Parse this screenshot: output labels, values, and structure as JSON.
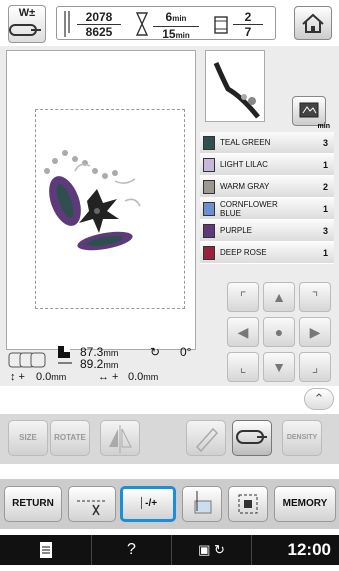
{
  "topbar": {
    "wt_label": "W±",
    "stitch_current": "2078",
    "stitch_total": "8625",
    "time_current": "6",
    "time_total": "15",
    "time_unit": "min",
    "color_current": "2",
    "color_total": "7"
  },
  "colors": {
    "min_label": "min",
    "items": [
      {
        "name": "TEAL GREEN",
        "count": "3",
        "color": "#2f4f4f"
      },
      {
        "name": "LIGHT LILAC",
        "count": "1",
        "color": "#c8b8d8"
      },
      {
        "name": "WARM GRAY",
        "count": "2",
        "color": "#9a9890"
      },
      {
        "name": "CORNFLOWER BLUE",
        "count": "1",
        "color": "#6d8fd1"
      },
      {
        "name": "PURPLE",
        "count": "3",
        "color": "#5d3a7a"
      },
      {
        "name": "DEEP ROSE",
        "count": "1",
        "color": "#9a2040"
      }
    ]
  },
  "info": {
    "width": "87.3",
    "height": "89.2",
    "unit": "mm",
    "rotation": "0°",
    "offset_v": "0.0",
    "offset_h": "0.0"
  },
  "edit_buttons": {
    "size": "SIZE",
    "rotate": "ROTATE",
    "density": "DENSITY"
  },
  "bottom_buttons": {
    "return": "RETURN",
    "stitch_nav": "-/+",
    "memory": "MEMORY"
  },
  "statusbar": {
    "help": "?",
    "time": "12:00"
  }
}
